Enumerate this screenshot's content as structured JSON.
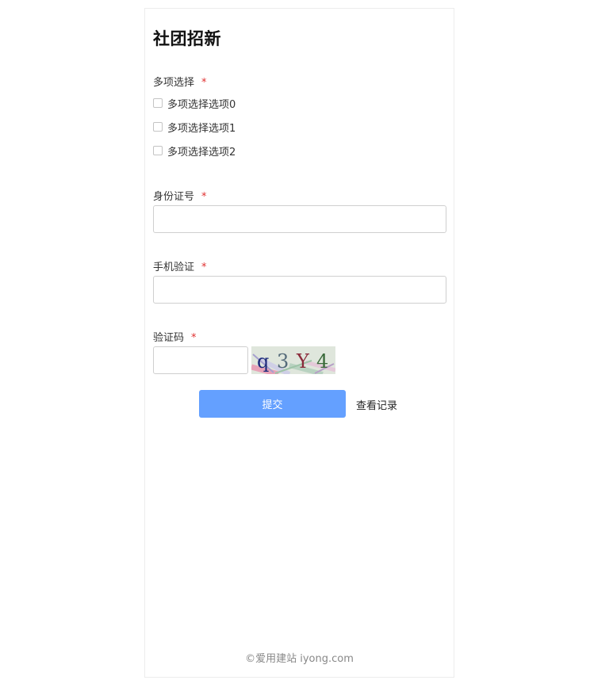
{
  "form": {
    "title": "社团招新",
    "required_mark": "*",
    "multi_select": {
      "label": "多项选择",
      "options": [
        "多项选择选项0",
        "多项选择选项1",
        "多项选择选项2"
      ]
    },
    "id_number": {
      "label": "身份证号",
      "value": "",
      "placeholder": ""
    },
    "phone_verify": {
      "label": "手机验证",
      "value": "",
      "placeholder": ""
    },
    "captcha": {
      "label": "验证码",
      "value": "",
      "placeholder": "",
      "code": "q3Y4"
    },
    "submit_label": "提交",
    "records_label": "查看记录",
    "accent_color": "#64a0ff"
  },
  "footer": {
    "text": "©爱用建站 iyong.com"
  }
}
